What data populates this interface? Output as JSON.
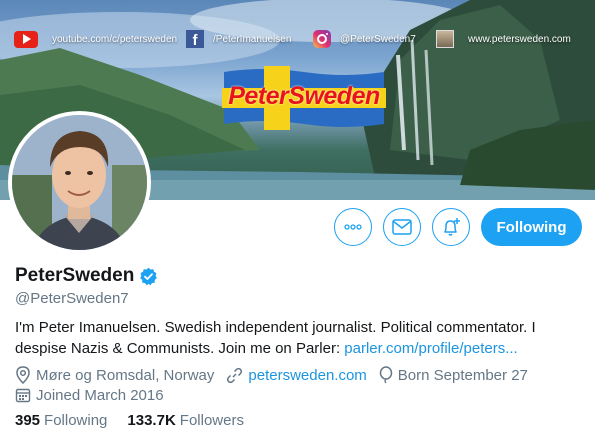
{
  "banner": {
    "social": {
      "youtube": "youtube.com/c/petersweden",
      "facebook": "/PeterImanuelsen",
      "instagram": "@PeterSweden7",
      "website": "www.petersweden.com"
    },
    "logo_text": "PeterSweden"
  },
  "actions": {
    "follow_label": "Following"
  },
  "profile": {
    "display_name": "PeterSweden",
    "handle": "@PeterSweden7",
    "bio_text": "I'm Peter Imanuelsen. Swedish independent journalist. Political commentator. I despise Nazis & Communists. Join me on Parler: ",
    "bio_link": "parler.com/profile/peters...",
    "location": "Møre og Romsdal, Norway",
    "website": "petersweden.com",
    "birthday": "Born September 27",
    "joined": "Joined March 2016"
  },
  "stats": {
    "following_count": "395",
    "following_label": "Following",
    "followers_count": "133.7K",
    "followers_label": "Followers"
  },
  "colors": {
    "accent": "#1da1f2",
    "link": "#1b95e0",
    "muted": "#657786",
    "text": "#14171a"
  },
  "icons": [
    "youtube-icon",
    "facebook-icon",
    "instagram-icon",
    "website-avatar-icon",
    "more-icon",
    "mail-icon",
    "bell-plus-icon",
    "verified-badge-icon",
    "location-icon",
    "link-icon",
    "balloon-icon",
    "calendar-icon"
  ]
}
